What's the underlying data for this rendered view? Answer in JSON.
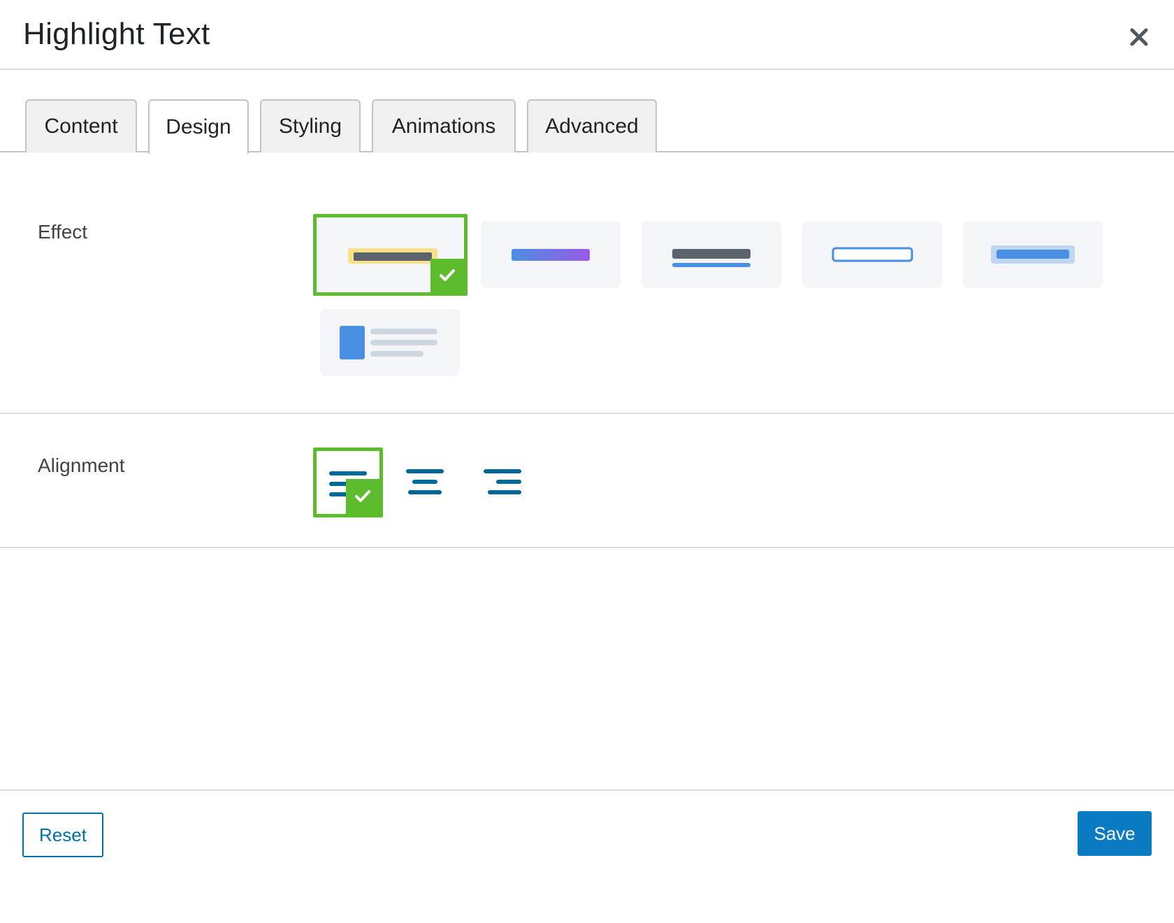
{
  "dialog": {
    "title": "Highlight Text",
    "close_icon": "close-icon"
  },
  "tabs": [
    {
      "label": "Content",
      "active": false
    },
    {
      "label": "Design",
      "active": true
    },
    {
      "label": "Styling",
      "active": false
    },
    {
      "label": "Animations",
      "active": false
    },
    {
      "label": "Advanced",
      "active": false
    }
  ],
  "effect": {
    "label": "Effect",
    "options": [
      {
        "name": "marker-highlight",
        "selected": true
      },
      {
        "name": "gradient-highlight",
        "selected": false
      },
      {
        "name": "underline",
        "selected": false
      },
      {
        "name": "outline-box",
        "selected": false
      },
      {
        "name": "soft-background",
        "selected": false
      },
      {
        "name": "block-side",
        "selected": false
      }
    ]
  },
  "alignment": {
    "label": "Alignment",
    "options": [
      {
        "name": "align-left",
        "selected": true
      },
      {
        "name": "align-center",
        "selected": false
      },
      {
        "name": "align-right",
        "selected": false
      }
    ]
  },
  "footer": {
    "reset_label": "Reset",
    "save_label": "Save"
  },
  "colors": {
    "accent_green": "#5dbb2e",
    "primary_blue": "#0a7ac2",
    "link_blue": "#0073aa",
    "highlight_yellow": "#fbe08a",
    "gradient_start": "#4a90e2",
    "gradient_end": "#9b59e6"
  }
}
